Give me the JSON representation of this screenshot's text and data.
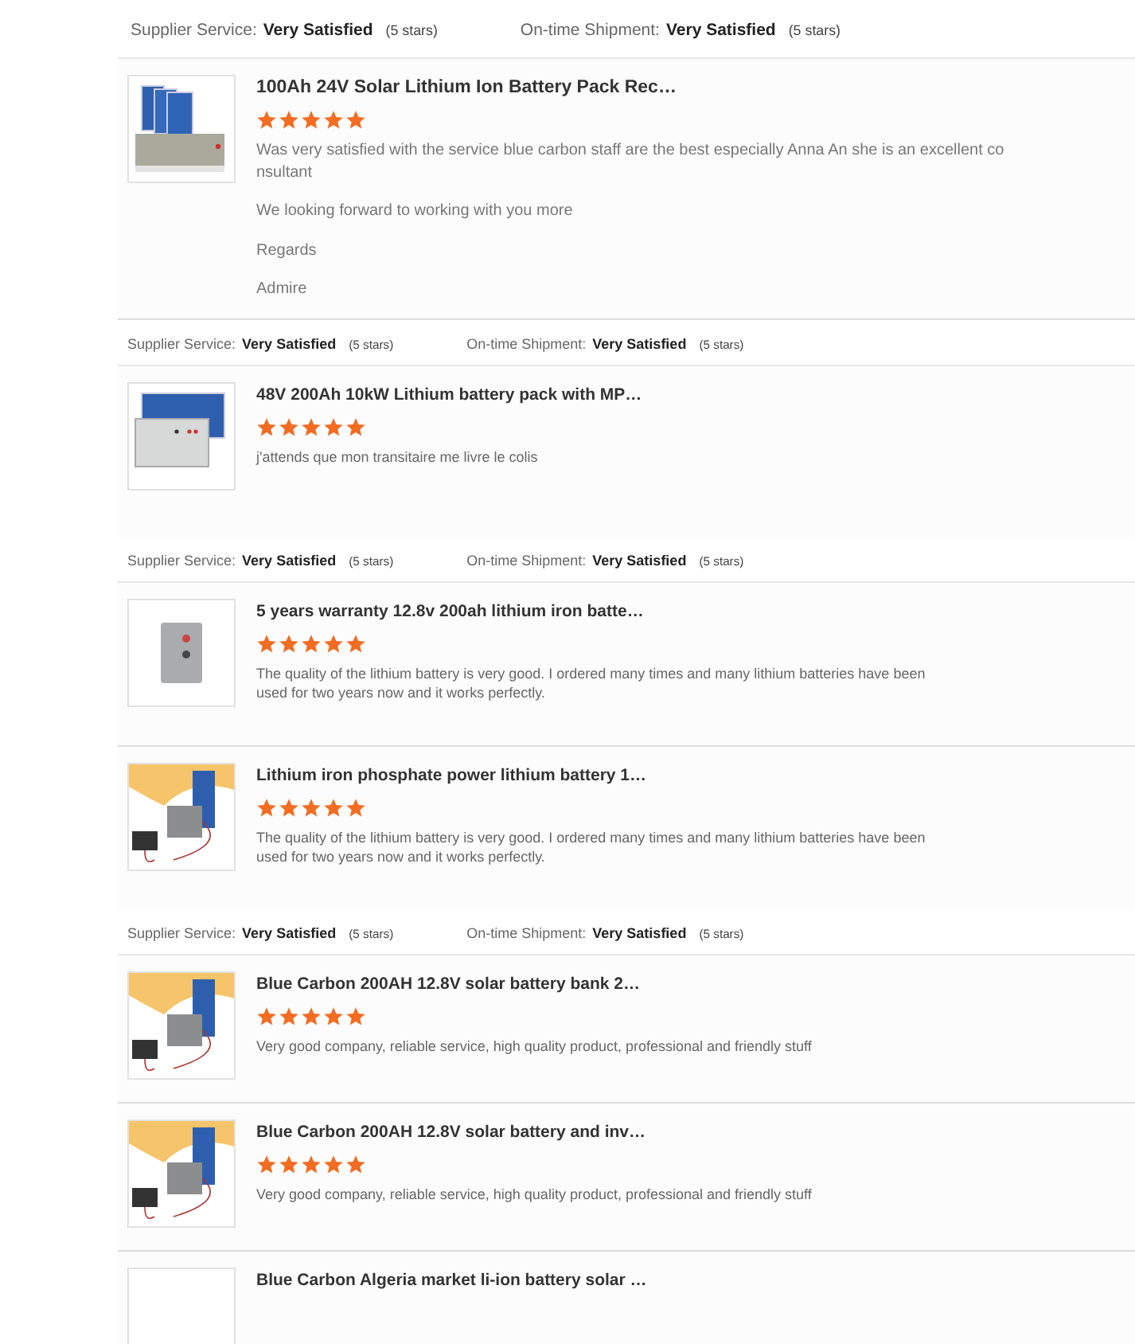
{
  "review_groups": [
    {
      "ratings": [
        {
          "label": "Supplier Service:",
          "value": "Very Satisfied",
          "stars_text": "(5 stars)"
        },
        {
          "label": "On-time Shipment:",
          "value": "Very Satisfied",
          "stars_text": "(5 stars)"
        }
      ],
      "reviews": [
        {
          "kind": "panels-battery",
          "title": "100Ah 24V Solar Lithium Ion Battery Pack Rec…",
          "stars": 5,
          "paragraphs": [
            "Was very satisfied with the service blue carbon staff are the best especially Anna An she is an excellent consultant",
            "We looking forward to working with you more",
            "Regards",
            "Admire"
          ]
        }
      ]
    },
    {
      "ratings": [
        {
          "label": "Supplier Service:",
          "value": "Very Satisfied",
          "stars_text": "(5 stars)"
        },
        {
          "label": "On-time Shipment:",
          "value": "Very Satisfied",
          "stars_text": "(5 stars)"
        }
      ],
      "reviews": [
        {
          "kind": "panel-cabinet",
          "title": "48V 200Ah 10kW Lithium battery pack with MP…",
          "stars": 5,
          "paragraphs": [
            "j'attends que mon transitaire me livre le colis"
          ]
        }
      ]
    },
    {
      "ratings": [
        {
          "label": "Supplier Service:",
          "value": "Very Satisfied",
          "stars_text": "(5 stars)"
        },
        {
          "label": "On-time Shipment:",
          "value": "Very Satisfied",
          "stars_text": "(5 stars)"
        }
      ],
      "reviews": [
        {
          "kind": "battery-unit",
          "title": "5 years warranty 12.8v 200ah lithium iron batte…",
          "stars": 5,
          "paragraphs": [
            "The quality of the lithium battery is very good. I ordered many times and many lithium batteries have been used for two years now and it works perfectly."
          ]
        },
        {
          "kind": "solar-system",
          "title": "Lithium iron phosphate power lithium battery 1…",
          "stars": 5,
          "paragraphs": [
            "The quality of the lithium battery is very good. I ordered many times and many lithium batteries have been used for two years now and it works perfectly."
          ]
        }
      ]
    },
    {
      "ratings": [
        {
          "label": "Supplier Service:",
          "value": "Very Satisfied",
          "stars_text": "(5 stars)"
        },
        {
          "label": "On-time Shipment:",
          "value": "Very Satisfied",
          "stars_text": "(5 stars)"
        }
      ],
      "reviews": [
        {
          "kind": "solar-system",
          "title": "Blue Carbon 200AH 12.8V solar battery bank 2…",
          "stars": 5,
          "paragraphs": [
            "Very good company, reliable service, high quality product, professional and friendly stuff"
          ]
        },
        {
          "kind": "solar-system",
          "title": "Blue Carbon 200AH 12.8V solar battery and inv…",
          "stars": 5,
          "paragraphs": [
            "Very good company, reliable service, high quality product, professional and friendly stuff"
          ]
        },
        {
          "title": "Blue Carbon Algeria market li-ion battery solar …"
        }
      ]
    }
  ]
}
